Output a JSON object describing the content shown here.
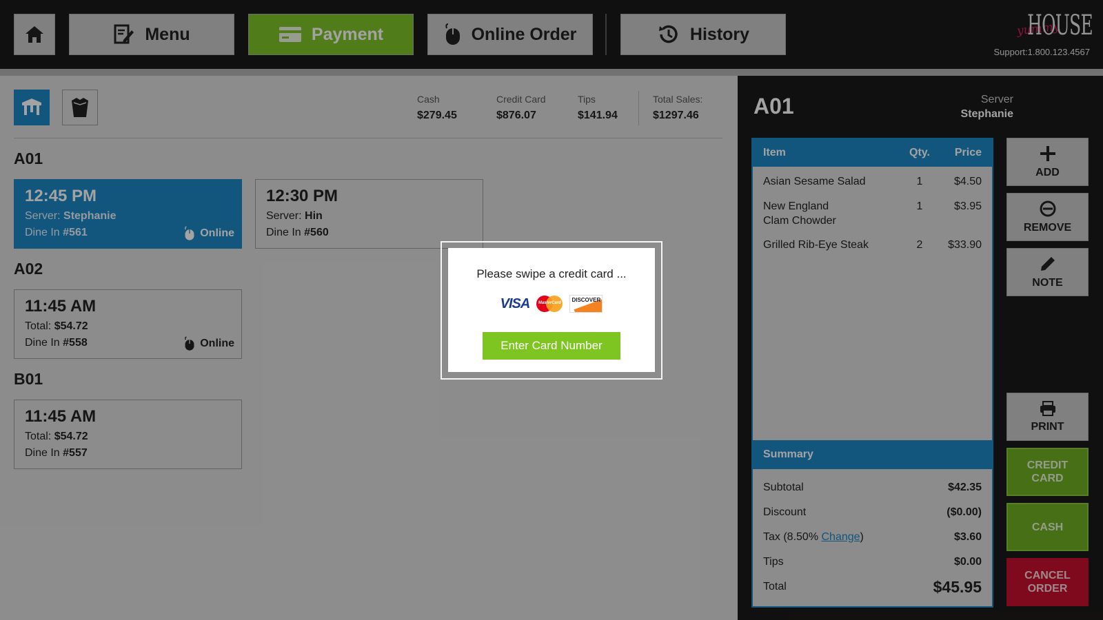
{
  "nav": {
    "menu": "Menu",
    "payment": "Payment",
    "online_order": "Online Order",
    "history": "History"
  },
  "brand": {
    "logo_script": "yummy",
    "logo_word": "HOUSE",
    "support": "Support:1.800.123.4567"
  },
  "stats": {
    "cash_label": "Cash",
    "cash_value": "$279.45",
    "credit_label": "Credit Card",
    "credit_value": "$876.07",
    "tips_label": "Tips",
    "tips_value": "$141.94",
    "total_label": "Total Sales:",
    "total_value": "$1297.46"
  },
  "tables": [
    {
      "name": "A01",
      "orders": [
        {
          "time": "12:45 PM",
          "line1_label": "Server: ",
          "line1_value": "Stephanie",
          "line2_label": "Dine In ",
          "line2_value": "#561",
          "online": "Online"
        },
        {
          "time": "12:30 PM",
          "line1_label": "Server: ",
          "line1_value": "Hin",
          "line2_label": "Dine In ",
          "line2_value": "#560"
        }
      ]
    },
    {
      "name": "A02",
      "orders": [
        {
          "time": "11:45 AM",
          "line1_label": "Total: ",
          "line1_value": "$54.72",
          "line2_label": "Dine In ",
          "line2_value": "#558",
          "online": "Online"
        }
      ]
    },
    {
      "name": "B01",
      "orders": [
        {
          "time": "11:45 AM",
          "line1_label": "Total: ",
          "line1_value": "$54.72",
          "line2_label": "Dine In ",
          "line2_value": "#557"
        }
      ]
    }
  ],
  "order": {
    "table": "A01",
    "server_label": "Server",
    "server_name": "Stephanie",
    "headers": {
      "item": "Item",
      "qty": "Qty.",
      "price": "Price"
    },
    "items": [
      {
        "name": "Asian Sesame Salad",
        "qty": "1",
        "price": "$4.50"
      },
      {
        "name": "New England Clam Chowder",
        "qty": "1",
        "price": "$3.95"
      },
      {
        "name": "Grilled Rib-Eye Steak",
        "qty": "2",
        "price": "$33.90"
      }
    ],
    "summary": {
      "title": "Summary",
      "subtotal_label": "Subtotal",
      "subtotal": "$42.35",
      "discount_label": "Discount",
      "discount": "($0.00)",
      "tax_label_pre": "Tax (8.50% ",
      "tax_change": "Change",
      "tax_label_post": ")",
      "tax": "$3.60",
      "tips_label": "Tips",
      "tips": "$0.00",
      "total_label": "Total",
      "total": "$45.95"
    }
  },
  "actions": {
    "add": "ADD",
    "remove": "REMOVE",
    "note": "NOTE",
    "print": "PRINT",
    "credit_card_1": "CREDIT",
    "credit_card_2": "CARD",
    "cash": "CASH",
    "cancel_1": "CANCEL",
    "cancel_2": "ORDER"
  },
  "modal": {
    "message": "Please swipe a credit card ...",
    "visa": "VISA",
    "mastercard": "MasterCard",
    "discover": "DISCOVER",
    "button": "Enter Card Number"
  },
  "colors": {
    "accent_blue": "#1d87c4",
    "accent_green": "#7fc22a",
    "danger_red": "#c8102e",
    "topbar": "#1c1a19"
  }
}
